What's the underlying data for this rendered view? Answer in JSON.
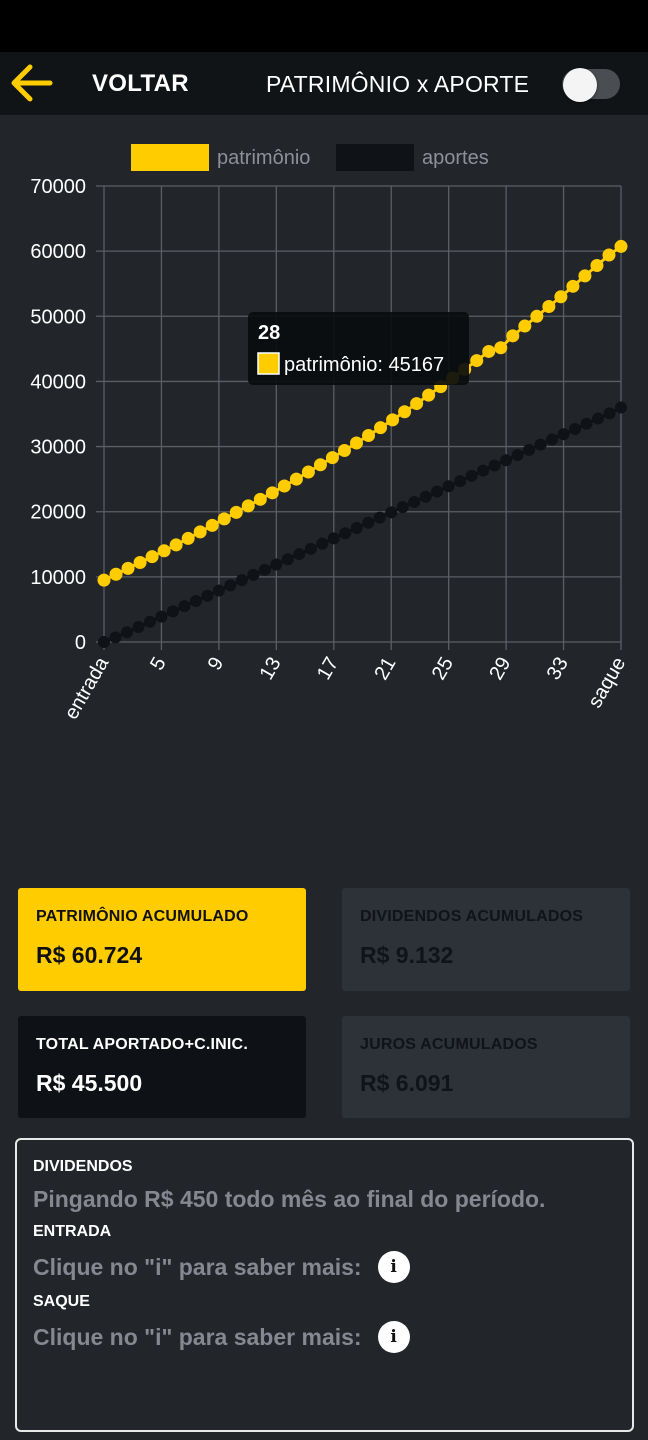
{
  "header": {
    "back_label": "VOLTAR",
    "title": "PATRIMÔNIO x APORTE",
    "toggle_on": false
  },
  "chart_data": {
    "type": "line",
    "legend": [
      "patrimônio",
      "aportes"
    ],
    "x_tick_labels": [
      "entrada",
      "5",
      "9",
      "13",
      "17",
      "21",
      "25",
      "29",
      "33",
      "saque"
    ],
    "ylim": [
      0,
      70000
    ],
    "y_ticks": [
      0,
      10000,
      20000,
      30000,
      40000,
      50000,
      60000,
      70000
    ],
    "grid": true,
    "colors": {
      "patrimonio": "#ffcc00",
      "aportes": "#0f1216"
    },
    "series": [
      {
        "name": "patrimônio",
        "values": [
          9500,
          10400,
          11300,
          12200,
          13100,
          14000,
          14900,
          15900,
          16900,
          17900,
          18900,
          19900,
          20900,
          21900,
          22900,
          23950,
          25000,
          26100,
          27200,
          28300,
          29400,
          30550,
          31700,
          32900,
          34100,
          35350,
          36600,
          37900,
          39200,
          40500,
          41850,
          43200,
          44600,
          45167,
          47000,
          48500,
          50000,
          51500,
          53000,
          54600,
          56200,
          57800,
          59400,
          60724
        ]
      },
      {
        "name": "aportes",
        "values": [
          0,
          700,
          1500,
          2300,
          3100,
          3900,
          4700,
          5500,
          6300,
          7100,
          7900,
          8700,
          9500,
          10300,
          11100,
          11900,
          12700,
          13500,
          14300,
          15100,
          15900,
          16700,
          17500,
          18300,
          19100,
          19900,
          20700,
          21500,
          22300,
          23100,
          23900,
          24700,
          25500,
          26300,
          27100,
          27900,
          28700,
          29500,
          30300,
          31100,
          31900,
          32700,
          33500,
          34300,
          35100,
          36000
        ]
      }
    ],
    "tooltip": {
      "title": "28",
      "label": "patrimônio: 45167"
    }
  },
  "cards": {
    "patrimonio": {
      "title": "PATRIMÔNIO ACUMULADO",
      "value": "R$ 60.724"
    },
    "dividendos": {
      "title": "DIVIDENDOS ACUMULADOS",
      "value": "R$ 9.132"
    },
    "total": {
      "title": "TOTAL APORTADO+C.INIC.",
      "value": "R$ 45.500"
    },
    "juros": {
      "title": "JUROS ACUMULADOS",
      "value": "R$ 6.091"
    }
  },
  "info": {
    "dividendos_label": "DIVIDENDOS",
    "dividendos_text": "Pingando R$ 450 todo mês ao final do período.",
    "entrada_label": "ENTRADA",
    "entrada_text": "Clique no \"i\" para saber mais:",
    "saque_label": "SAQUE",
    "saque_text": "Clique no \"i\" para saber mais:",
    "info_icon_name": "info-icon"
  }
}
